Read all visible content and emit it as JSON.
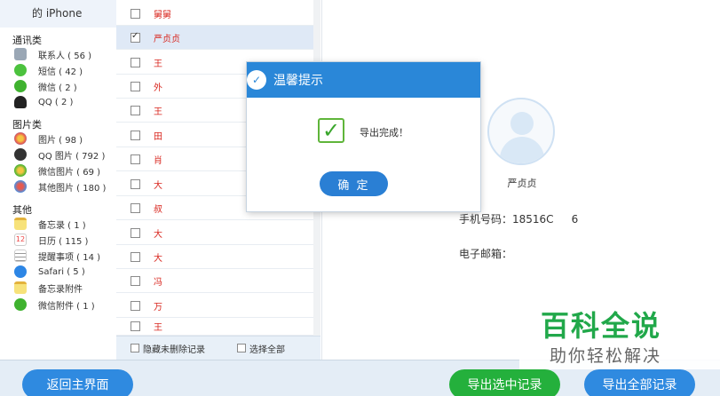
{
  "sidebar": {
    "device": "的 iPhone",
    "categories": [
      {
        "title": "通讯类",
        "items": [
          {
            "label": "联系人 ( 56 )",
            "icon": "contacts-icon"
          },
          {
            "label": "短信 ( 42 )",
            "icon": "sms-icon"
          },
          {
            "label": "微信 ( 2 )",
            "icon": "wechat-icon"
          },
          {
            "label": "QQ ( 2 )",
            "icon": "qq-icon"
          }
        ]
      },
      {
        "title": "图片类",
        "items": [
          {
            "label": "图片 ( 98 )",
            "icon": "photos-icon"
          },
          {
            "label": "QQ 图片 ( 792 )",
            "icon": "qq-photos-icon"
          },
          {
            "label": "微信图片 ( 69 )",
            "icon": "wechat-photos-icon"
          },
          {
            "label": "其他图片 ( 180 )",
            "icon": "other-photos-icon"
          }
        ]
      },
      {
        "title": "其他",
        "items": [
          {
            "label": "备忘录 ( 1 )",
            "icon": "notes-icon"
          },
          {
            "label": "日历 ( 115 )",
            "icon": "calendar-icon"
          },
          {
            "label": "提醒事项 ( 14 )",
            "icon": "reminders-icon"
          },
          {
            "label": "Safari ( 5 )",
            "icon": "safari-icon"
          },
          {
            "label": "备忘录附件",
            "icon": "notes-attachment-icon"
          },
          {
            "label": "微信附件 ( 1 )",
            "icon": "wechat-attachment-icon"
          }
        ]
      }
    ]
  },
  "list": {
    "rows": [
      {
        "name": "舅舅",
        "checked": false
      },
      {
        "name": "严贞贞",
        "checked": true
      },
      {
        "name": "王",
        "checked": false
      },
      {
        "name": "外",
        "checked": false
      },
      {
        "name": "王",
        "checked": false
      },
      {
        "name": "田",
        "checked": false
      },
      {
        "name": "肖",
        "checked": false
      },
      {
        "name": "大",
        "checked": false
      },
      {
        "name": "叔",
        "checked": false
      },
      {
        "name": "大",
        "checked": false
      },
      {
        "name": "大",
        "checked": false
      },
      {
        "name": "冯",
        "checked": false
      },
      {
        "name": "万",
        "checked": false
      },
      {
        "name": "王",
        "checked": false
      }
    ],
    "footer": {
      "hide_deleted": "隐藏未删除记录",
      "select_all": "选择全部"
    }
  },
  "detail": {
    "name": "严贞贞",
    "phone_label": "手机号码：18516C",
    "phone_tail": "6",
    "email_label": "电子邮箱："
  },
  "dialog": {
    "title": "温馨提示",
    "message": "导出完成！",
    "ok": "确 定"
  },
  "bottom": {
    "home": "返回主界面",
    "export_selected": "导出选中记录",
    "export_all": "导出全部记录"
  },
  "watermark": {
    "title": "百科全说",
    "subtitle": "助你轻松解决"
  },
  "colors": {
    "accent_blue": "#2f8ae0",
    "accent_green": "#24b03c",
    "contact_red": "#d8261e"
  }
}
